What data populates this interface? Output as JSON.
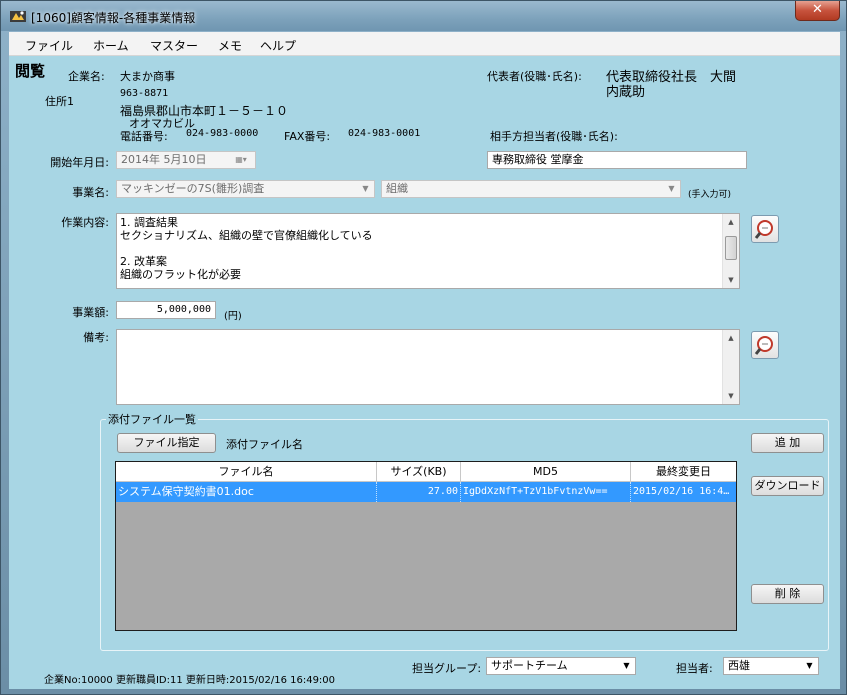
{
  "window": {
    "title": "[1060]顧客情報-各種事業情報",
    "close_label": "✕"
  },
  "menu": [
    "ファイル",
    "ホーム",
    "マスター",
    "メモ",
    "ヘルプ"
  ],
  "header": {
    "mode": "閲覧",
    "company_label": "企業名:",
    "company_name": "大まか商事",
    "representative_label": "代表者(役職･氏名):",
    "representative_line1": "代表取締役社長　大間",
    "representative_line2": "内蔵助",
    "address_label": "住所1",
    "postal_code": "963-8871",
    "address": "福島県郡山市本町１－５－１０",
    "address_kana": "オオマカビル",
    "phone_label": "電話番号:",
    "phone": "024-983-0000",
    "fax_label": "FAX番号:",
    "fax": "024-983-0001",
    "counterpart_label": "相手方担当者(役職･氏名):"
  },
  "form": {
    "start_date_label": "開始年月日:",
    "start_date": "2014年  5月10日",
    "counterpart_value": "専務取締役  堂摩金",
    "business_label": "事業名:",
    "business_name": "マッキンゼーの7S(雛形)調査",
    "business_category": "組織",
    "manual_entry_note": "(手入力可)",
    "work_label": "作業内容:",
    "work_lines": [
      "1.  調査結果",
      "  セクショナリズム、組織の壁で官僚組織化している",
      "",
      "2.  改革案",
      "  組織のフラット化が必要"
    ],
    "amount_label": "事業額:",
    "amount": "5,000,000",
    "amount_unit": "(円)",
    "notes_label": "備考:",
    "notes": ""
  },
  "attachments": {
    "group_title": "添付ファイル一覧",
    "specify_button": "ファイル指定",
    "filename_label": "添付ファイル名",
    "columns": [
      "ファイル名",
      "サイズ(KB)",
      "MD5",
      "最終変更日"
    ],
    "rows": [
      {
        "name": "システム保守契約書01.doc",
        "size": "27.00",
        "md5": "IgDdXzNfT+TzV1bFvtnzVw==",
        "modified": "2015/02/16  16:4…"
      }
    ],
    "add_button": "追  加",
    "download_button": "ダウンロード",
    "delete_button": "削  除"
  },
  "footer": {
    "company_no_label": "企業No:",
    "company_no": "10000",
    "updater_label": "更新職員ID:",
    "updater_id": "11",
    "updated_label": "更新日時:",
    "updated_at": "2015/02/16 16:49:00",
    "group_label": "担当グループ:",
    "group_value": "サポートチーム",
    "staff_label": "担当者:",
    "staff_value": "西雄"
  }
}
